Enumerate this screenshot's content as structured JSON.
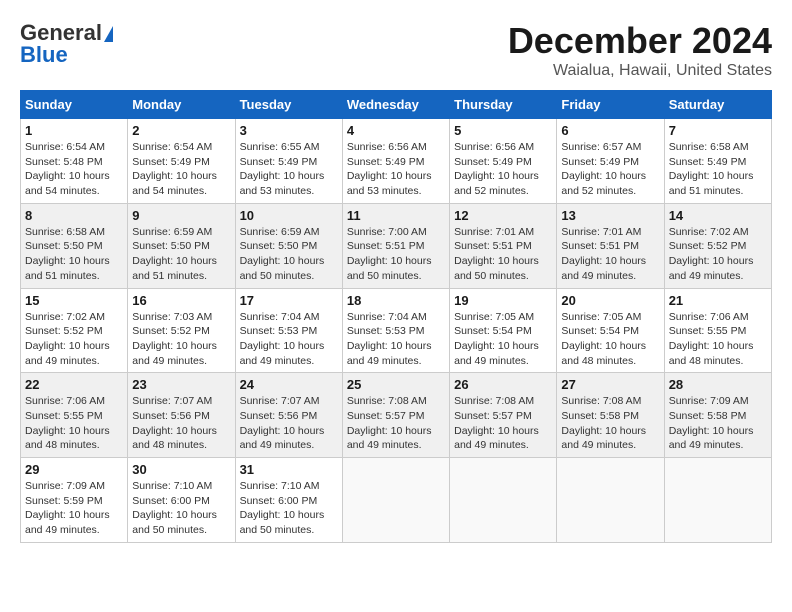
{
  "header": {
    "logo_general": "General",
    "logo_blue": "Blue",
    "month_title": "December 2024",
    "location": "Waialua, Hawaii, United States"
  },
  "weekdays": [
    "Sunday",
    "Monday",
    "Tuesday",
    "Wednesday",
    "Thursday",
    "Friday",
    "Saturday"
  ],
  "weeks": [
    [
      {
        "day": "1",
        "sunrise": "6:54 AM",
        "sunset": "5:48 PM",
        "daylight": "10 hours and 54 minutes."
      },
      {
        "day": "2",
        "sunrise": "6:54 AM",
        "sunset": "5:49 PM",
        "daylight": "10 hours and 54 minutes."
      },
      {
        "day": "3",
        "sunrise": "6:55 AM",
        "sunset": "5:49 PM",
        "daylight": "10 hours and 53 minutes."
      },
      {
        "day": "4",
        "sunrise": "6:56 AM",
        "sunset": "5:49 PM",
        "daylight": "10 hours and 53 minutes."
      },
      {
        "day": "5",
        "sunrise": "6:56 AM",
        "sunset": "5:49 PM",
        "daylight": "10 hours and 52 minutes."
      },
      {
        "day": "6",
        "sunrise": "6:57 AM",
        "sunset": "5:49 PM",
        "daylight": "10 hours and 52 minutes."
      },
      {
        "day": "7",
        "sunrise": "6:58 AM",
        "sunset": "5:49 PM",
        "daylight": "10 hours and 51 minutes."
      }
    ],
    [
      {
        "day": "8",
        "sunrise": "6:58 AM",
        "sunset": "5:50 PM",
        "daylight": "10 hours and 51 minutes."
      },
      {
        "day": "9",
        "sunrise": "6:59 AM",
        "sunset": "5:50 PM",
        "daylight": "10 hours and 51 minutes."
      },
      {
        "day": "10",
        "sunrise": "6:59 AM",
        "sunset": "5:50 PM",
        "daylight": "10 hours and 50 minutes."
      },
      {
        "day": "11",
        "sunrise": "7:00 AM",
        "sunset": "5:51 PM",
        "daylight": "10 hours and 50 minutes."
      },
      {
        "day": "12",
        "sunrise": "7:01 AM",
        "sunset": "5:51 PM",
        "daylight": "10 hours and 50 minutes."
      },
      {
        "day": "13",
        "sunrise": "7:01 AM",
        "sunset": "5:51 PM",
        "daylight": "10 hours and 49 minutes."
      },
      {
        "day": "14",
        "sunrise": "7:02 AM",
        "sunset": "5:52 PM",
        "daylight": "10 hours and 49 minutes."
      }
    ],
    [
      {
        "day": "15",
        "sunrise": "7:02 AM",
        "sunset": "5:52 PM",
        "daylight": "10 hours and 49 minutes."
      },
      {
        "day": "16",
        "sunrise": "7:03 AM",
        "sunset": "5:52 PM",
        "daylight": "10 hours and 49 minutes."
      },
      {
        "day": "17",
        "sunrise": "7:04 AM",
        "sunset": "5:53 PM",
        "daylight": "10 hours and 49 minutes."
      },
      {
        "day": "18",
        "sunrise": "7:04 AM",
        "sunset": "5:53 PM",
        "daylight": "10 hours and 49 minutes."
      },
      {
        "day": "19",
        "sunrise": "7:05 AM",
        "sunset": "5:54 PM",
        "daylight": "10 hours and 49 minutes."
      },
      {
        "day": "20",
        "sunrise": "7:05 AM",
        "sunset": "5:54 PM",
        "daylight": "10 hours and 48 minutes."
      },
      {
        "day": "21",
        "sunrise": "7:06 AM",
        "sunset": "5:55 PM",
        "daylight": "10 hours and 48 minutes."
      }
    ],
    [
      {
        "day": "22",
        "sunrise": "7:06 AM",
        "sunset": "5:55 PM",
        "daylight": "10 hours and 48 minutes."
      },
      {
        "day": "23",
        "sunrise": "7:07 AM",
        "sunset": "5:56 PM",
        "daylight": "10 hours and 48 minutes."
      },
      {
        "day": "24",
        "sunrise": "7:07 AM",
        "sunset": "5:56 PM",
        "daylight": "10 hours and 49 minutes."
      },
      {
        "day": "25",
        "sunrise": "7:08 AM",
        "sunset": "5:57 PM",
        "daylight": "10 hours and 49 minutes."
      },
      {
        "day": "26",
        "sunrise": "7:08 AM",
        "sunset": "5:57 PM",
        "daylight": "10 hours and 49 minutes."
      },
      {
        "day": "27",
        "sunrise": "7:08 AM",
        "sunset": "5:58 PM",
        "daylight": "10 hours and 49 minutes."
      },
      {
        "day": "28",
        "sunrise": "7:09 AM",
        "sunset": "5:58 PM",
        "daylight": "10 hours and 49 minutes."
      }
    ],
    [
      {
        "day": "29",
        "sunrise": "7:09 AM",
        "sunset": "5:59 PM",
        "daylight": "10 hours and 49 minutes."
      },
      {
        "day": "30",
        "sunrise": "7:10 AM",
        "sunset": "6:00 PM",
        "daylight": "10 hours and 50 minutes."
      },
      {
        "day": "31",
        "sunrise": "7:10 AM",
        "sunset": "6:00 PM",
        "daylight": "10 hours and 50 minutes."
      },
      null,
      null,
      null,
      null
    ]
  ]
}
